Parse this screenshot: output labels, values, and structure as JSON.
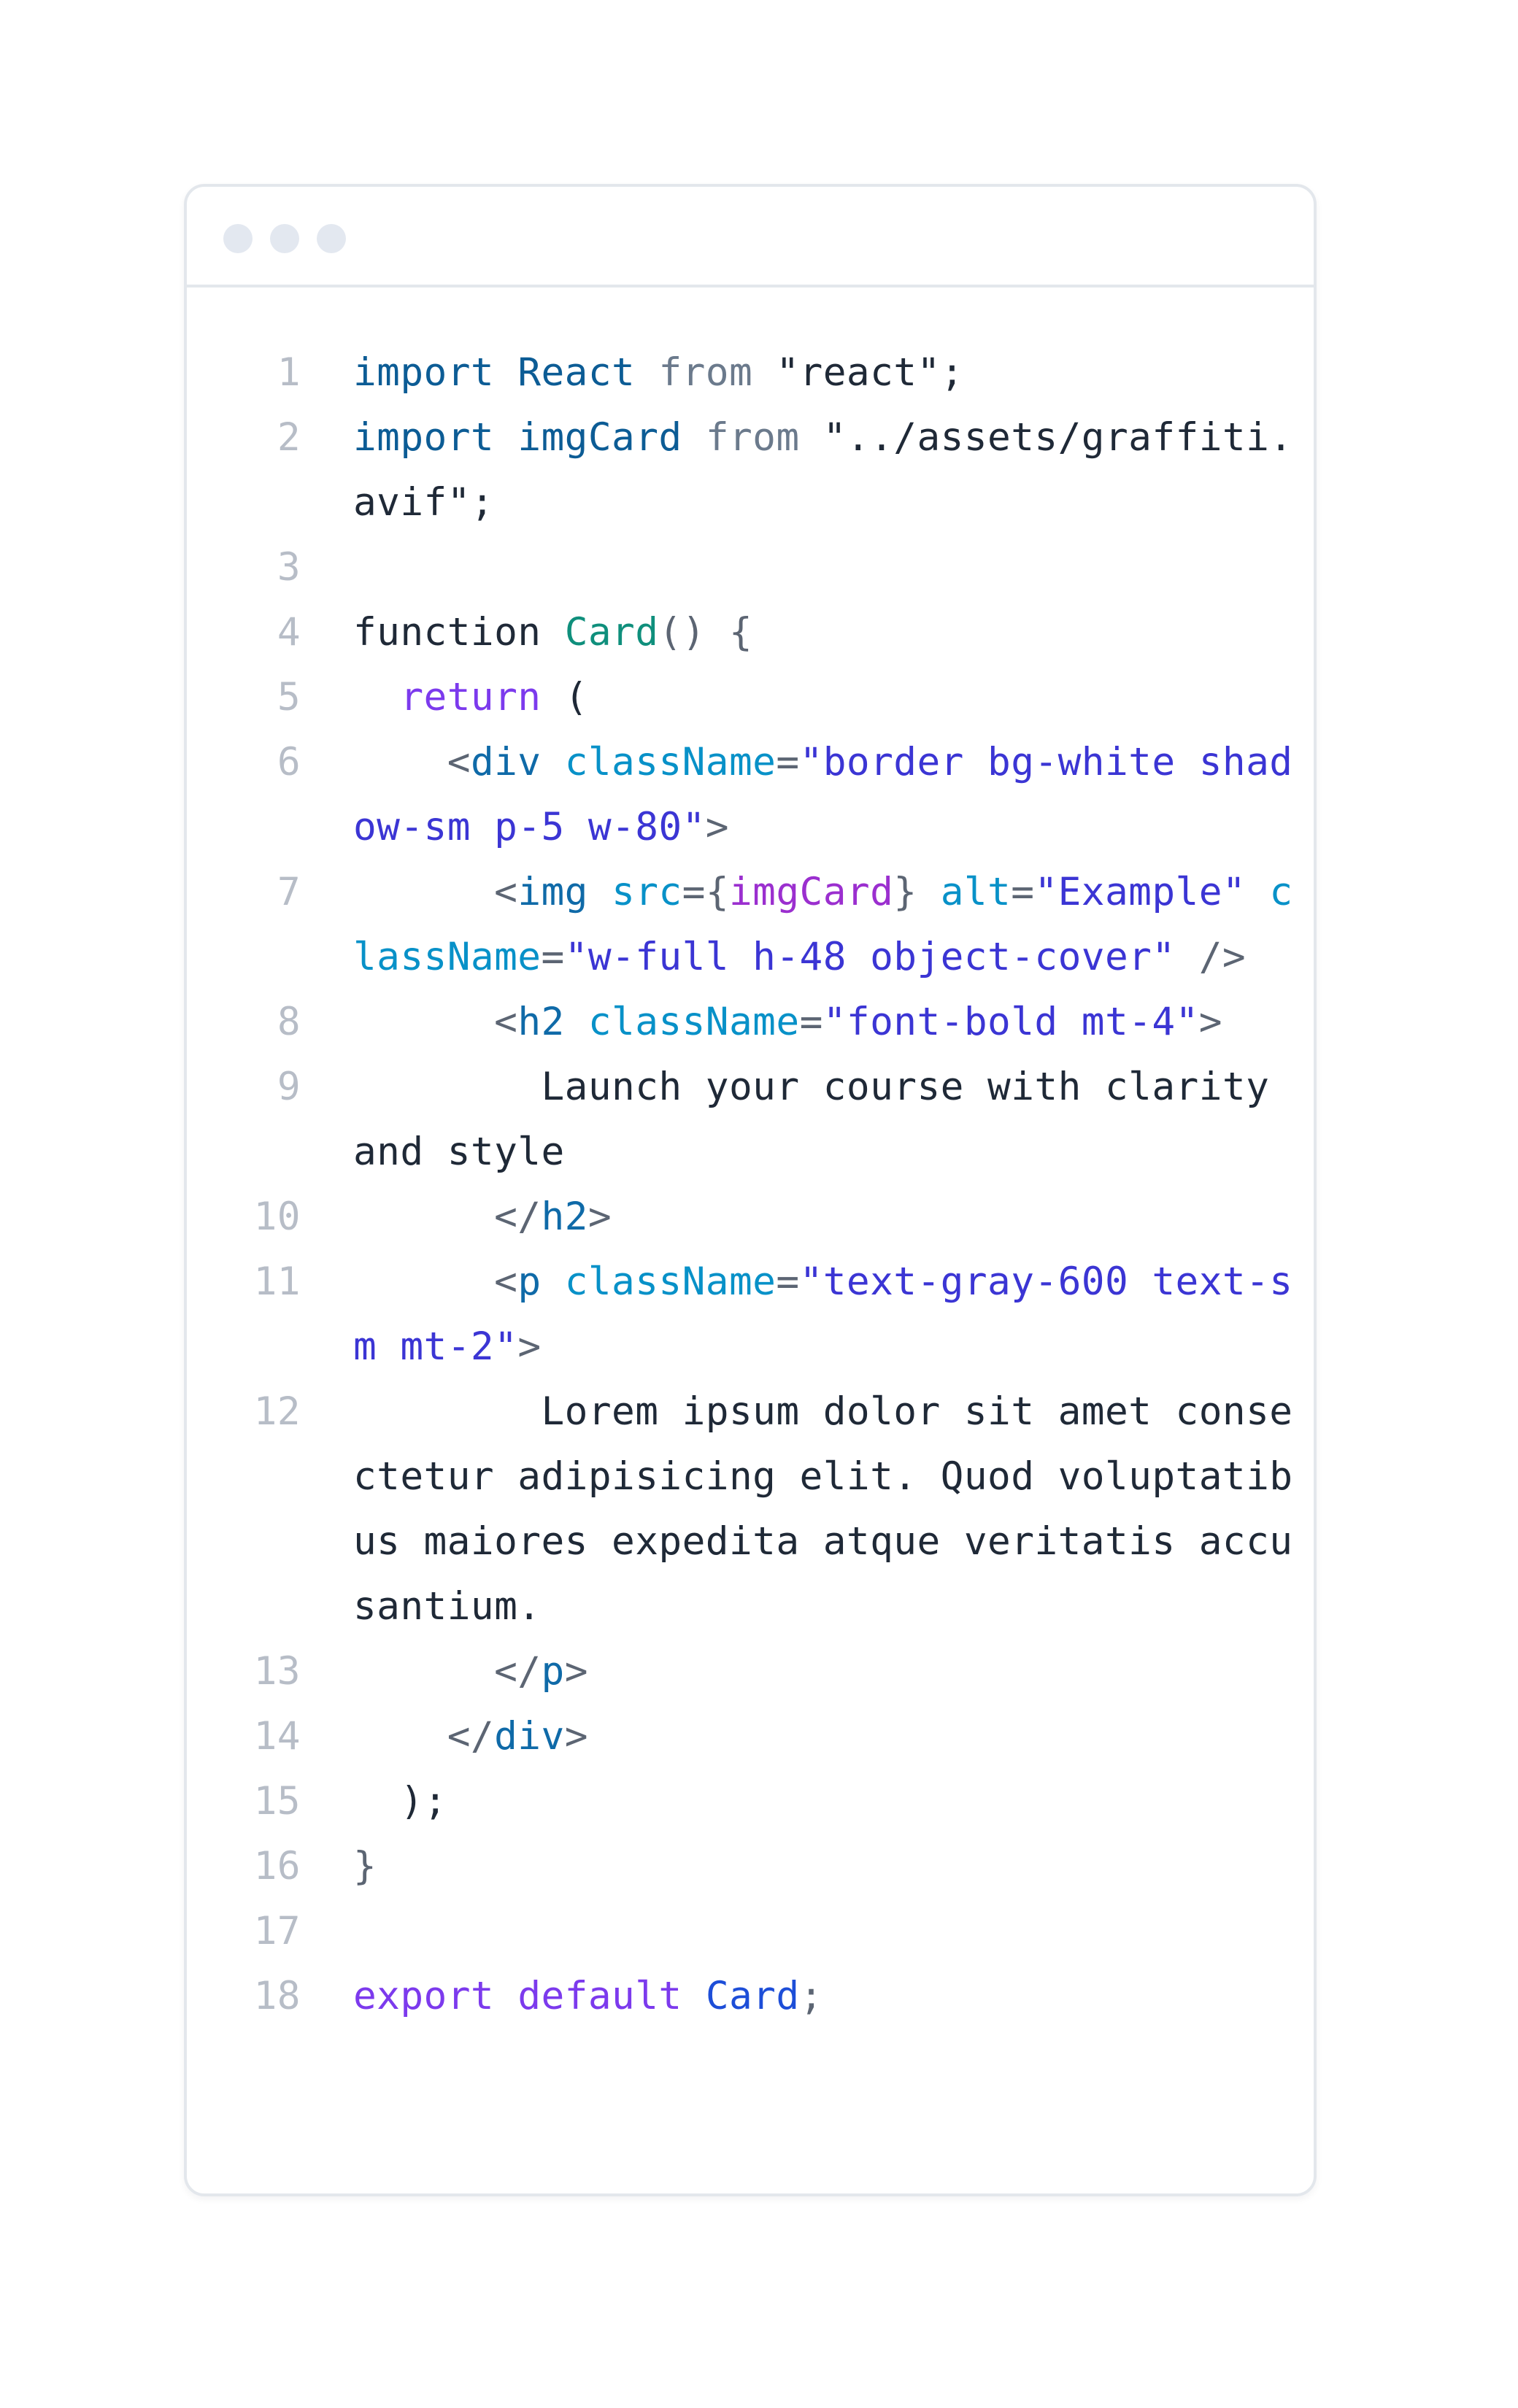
{
  "window": {
    "controls": [
      "window-dot-1",
      "window-dot-2",
      "window-dot-3"
    ]
  },
  "code": {
    "lines": [
      {
        "n": "1",
        "tokens": [
          {
            "t": "import",
            "c": "kw"
          },
          {
            "t": " ",
            "c": "text"
          },
          {
            "t": "React",
            "c": "kw"
          },
          {
            "t": " ",
            "c": "text"
          },
          {
            "t": "from",
            "c": "from"
          },
          {
            "t": " ",
            "c": "text"
          },
          {
            "t": "\"react\";",
            "c": "str"
          }
        ]
      },
      {
        "n": "2",
        "tokens": [
          {
            "t": "import",
            "c": "kw"
          },
          {
            "t": " ",
            "c": "text"
          },
          {
            "t": "imgCard",
            "c": "kw"
          },
          {
            "t": " ",
            "c": "text"
          },
          {
            "t": "from",
            "c": "from"
          },
          {
            "t": " ",
            "c": "text"
          },
          {
            "t": "\"../assets/graffiti.avif\";",
            "c": "str"
          }
        ]
      },
      {
        "n": "3",
        "tokens": []
      },
      {
        "n": "4",
        "tokens": [
          {
            "t": "function",
            "c": "text"
          },
          {
            "t": " ",
            "c": "text"
          },
          {
            "t": "Card",
            "c": "fn"
          },
          {
            "t": "() {",
            "c": "punc"
          }
        ]
      },
      {
        "n": "5",
        "tokens": [
          {
            "t": "  ",
            "c": "text"
          },
          {
            "t": "return",
            "c": "ret"
          },
          {
            "t": " (",
            "c": "text"
          }
        ]
      },
      {
        "n": "6",
        "tokens": [
          {
            "t": "    ",
            "c": "text"
          },
          {
            "t": "<",
            "c": "punc"
          },
          {
            "t": "div",
            "c": "tag"
          },
          {
            "t": " ",
            "c": "text"
          },
          {
            "t": "className",
            "c": "attr"
          },
          {
            "t": "=",
            "c": "punc"
          },
          {
            "t": "\"border bg-white shadow-sm p-5 w-80\"",
            "c": "val"
          },
          {
            "t": ">",
            "c": "punc"
          }
        ]
      },
      {
        "n": "7",
        "tokens": [
          {
            "t": "      ",
            "c": "text"
          },
          {
            "t": "<",
            "c": "punc"
          },
          {
            "t": "img",
            "c": "tag"
          },
          {
            "t": " ",
            "c": "text"
          },
          {
            "t": "src",
            "c": "attr"
          },
          {
            "t": "=",
            "c": "punc"
          },
          {
            "t": "{",
            "c": "punc"
          },
          {
            "t": "imgCard",
            "c": "expr"
          },
          {
            "t": "}",
            "c": "punc"
          },
          {
            "t": " ",
            "c": "text"
          },
          {
            "t": "alt",
            "c": "attr"
          },
          {
            "t": "=",
            "c": "punc"
          },
          {
            "t": "\"Example\"",
            "c": "val"
          },
          {
            "t": " ",
            "c": "text"
          },
          {
            "t": "className",
            "c": "attr"
          },
          {
            "t": "=",
            "c": "punc"
          },
          {
            "t": "\"w-full h-48 object-cover\"",
            "c": "val"
          },
          {
            "t": " />",
            "c": "punc"
          }
        ]
      },
      {
        "n": "8",
        "tokens": [
          {
            "t": "      ",
            "c": "text"
          },
          {
            "t": "<",
            "c": "punc"
          },
          {
            "t": "h2",
            "c": "tag"
          },
          {
            "t": " ",
            "c": "text"
          },
          {
            "t": "className",
            "c": "attr"
          },
          {
            "t": "=",
            "c": "punc"
          },
          {
            "t": "\"font-bold mt-4\"",
            "c": "val"
          },
          {
            "t": ">",
            "c": "punc"
          }
        ]
      },
      {
        "n": "9",
        "tokens": [
          {
            "t": "        Launch your course with clarity and style",
            "c": "text"
          }
        ]
      },
      {
        "n": "10",
        "tokens": [
          {
            "t": "      ",
            "c": "text"
          },
          {
            "t": "</",
            "c": "punc"
          },
          {
            "t": "h2",
            "c": "tag"
          },
          {
            "t": ">",
            "c": "punc"
          }
        ]
      },
      {
        "n": "11",
        "tokens": [
          {
            "t": "      ",
            "c": "text"
          },
          {
            "t": "<",
            "c": "punc"
          },
          {
            "t": "p",
            "c": "tag"
          },
          {
            "t": " ",
            "c": "text"
          },
          {
            "t": "className",
            "c": "attr"
          },
          {
            "t": "=",
            "c": "punc"
          },
          {
            "t": "\"text-gray-600 text-sm mt-2\"",
            "c": "val"
          },
          {
            "t": ">",
            "c": "punc"
          }
        ]
      },
      {
        "n": "12",
        "tokens": [
          {
            "t": "        Lorem ipsum dolor sit amet consectetur adipisicing elit. Quod voluptatibus maiores expedita atque veritatis accusantium.",
            "c": "text"
          }
        ]
      },
      {
        "n": "13",
        "tokens": [
          {
            "t": "      ",
            "c": "text"
          },
          {
            "t": "</",
            "c": "punc"
          },
          {
            "t": "p",
            "c": "tag"
          },
          {
            "t": ">",
            "c": "punc"
          }
        ]
      },
      {
        "n": "14",
        "tokens": [
          {
            "t": "    ",
            "c": "text"
          },
          {
            "t": "</",
            "c": "punc"
          },
          {
            "t": "div",
            "c": "tag"
          },
          {
            "t": ">",
            "c": "punc"
          }
        ]
      },
      {
        "n": "15",
        "tokens": [
          {
            "t": "  );",
            "c": "text"
          }
        ]
      },
      {
        "n": "16",
        "tokens": [
          {
            "t": "}",
            "c": "punc"
          }
        ]
      },
      {
        "n": "17",
        "tokens": []
      },
      {
        "n": "18",
        "tokens": [
          {
            "t": "export",
            "c": "exp"
          },
          {
            "t": " ",
            "c": "text"
          },
          {
            "t": "default",
            "c": "exp"
          },
          {
            "t": " ",
            "c": "text"
          },
          {
            "t": "Card",
            "c": "ident"
          },
          {
            "t": ";",
            "c": "punc"
          }
        ]
      }
    ]
  }
}
